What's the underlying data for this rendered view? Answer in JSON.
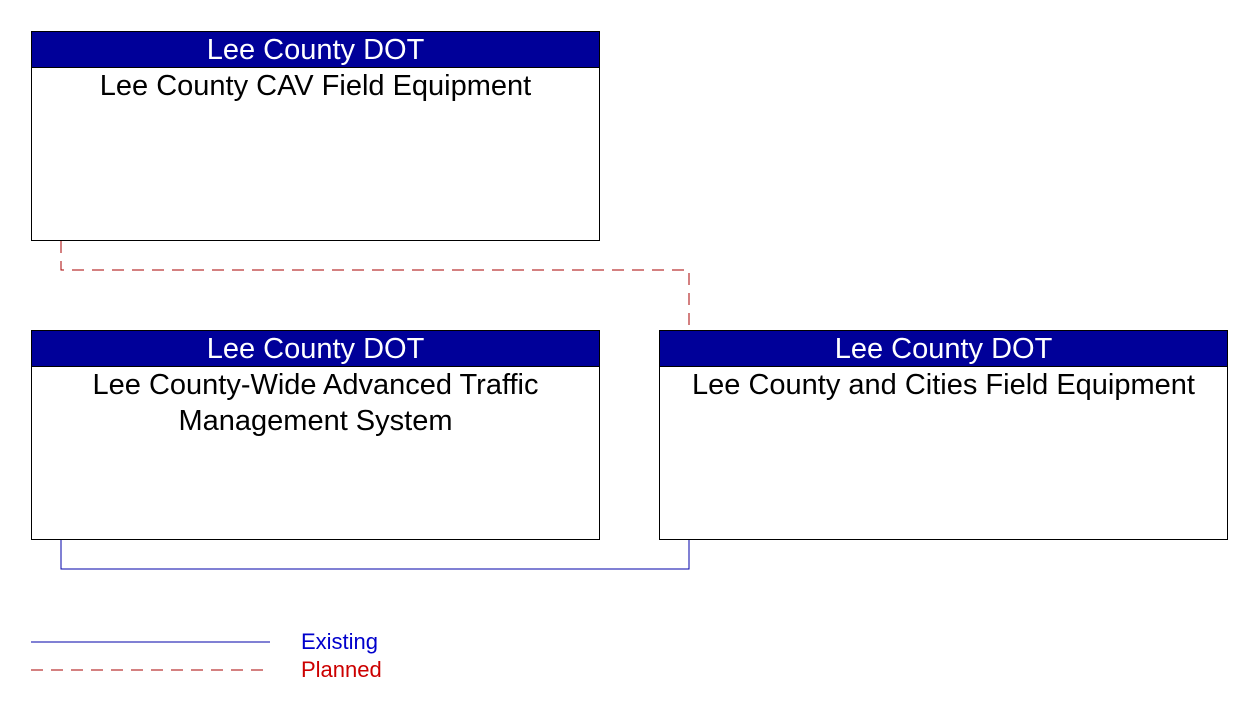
{
  "nodes": [
    {
      "id": "n1",
      "owner": "Lee County DOT",
      "name": "Lee County CAV Field Equipment"
    },
    {
      "id": "n2",
      "owner": "Lee County DOT",
      "name": "Lee County-Wide Advanced Traffic Management System"
    },
    {
      "id": "n3",
      "owner": "Lee County DOT",
      "name": "Lee County and Cities Field Equipment"
    }
  ],
  "connections": [
    {
      "from": "Lee County CAV Field Equipment",
      "to": "Lee County and Cities Field Equipment",
      "status": "Planned"
    },
    {
      "from": "Lee County-Wide Advanced Traffic Management System",
      "to": "Lee County and Cities Field Equipment",
      "status": "Existing"
    }
  ],
  "legend": {
    "existing": {
      "label": "Existing",
      "color": "#0000cc"
    },
    "planned": {
      "label": "Planned",
      "color": "#cc0000"
    }
  },
  "colors": {
    "header_bg": "#000099",
    "existing_line": "#0000aa",
    "planned_line": "#aa0000"
  }
}
